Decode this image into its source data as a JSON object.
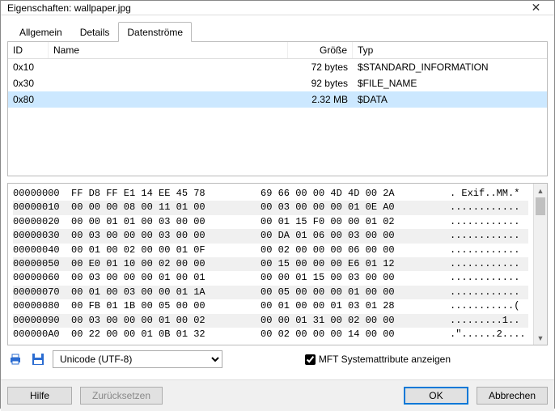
{
  "window": {
    "title": "Eigenschaften: wallpaper.jpg"
  },
  "tabs": {
    "t0": "Allgemein",
    "t1": "Details",
    "t2": "Datenströme"
  },
  "table": {
    "head": {
      "id": "ID",
      "name": "Name",
      "size": "Größe",
      "type": "Typ"
    },
    "rows": [
      {
        "id": "0x10",
        "name": "",
        "size": "72 bytes",
        "type": "$STANDARD_INFORMATION",
        "sel": false
      },
      {
        "id": "0x30",
        "name": "",
        "size": "92 bytes",
        "type": "$FILE_NAME",
        "sel": false
      },
      {
        "id": "0x80",
        "name": "",
        "size": "2.32 MB",
        "type": "$DATA",
        "sel": true
      }
    ]
  },
  "hex": {
    "lines": [
      {
        "off": "00000000",
        "b1": "FF D8 FF E1 14 EE 45 78",
        "b2": "69 66 00 00 4D 4D 00 2A",
        "ascii": ". Exif..MM.*"
      },
      {
        "off": "00000010",
        "b1": "00 00 00 08 00 11 01 00",
        "b2": "00 03 00 00 00 01 0E A0",
        "ascii": "............"
      },
      {
        "off": "00000020",
        "b1": "00 00 01 01 00 03 00 00",
        "b2": "00 01 15 F0 00 00 01 02",
        "ascii": "............"
      },
      {
        "off": "00000030",
        "b1": "00 03 00 00 00 03 00 00",
        "b2": "00 DA 01 06 00 03 00 00",
        "ascii": "............"
      },
      {
        "off": "00000040",
        "b1": "00 01 00 02 00 00 01 0F",
        "b2": "00 02 00 00 00 06 00 00",
        "ascii": "............"
      },
      {
        "off": "00000050",
        "b1": "00 E0 01 10 00 02 00 00",
        "b2": "00 15 00 00 00 E6 01 12",
        "ascii": "............"
      },
      {
        "off": "00000060",
        "b1": "00 03 00 00 00 01 00 01",
        "b2": "00 00 01 15 00 03 00 00",
        "ascii": "............"
      },
      {
        "off": "00000070",
        "b1": "00 01 00 03 00 00 01 1A",
        "b2": "00 05 00 00 00 01 00 00",
        "ascii": "............"
      },
      {
        "off": "00000080",
        "b1": "00 FB 01 1B 00 05 00 00",
        "b2": "00 01 00 00 01 03 01 28",
        "ascii": "...........("
      },
      {
        "off": "00000090",
        "b1": "00 03 00 00 00 01 00 02",
        "b2": "00 00 01 31 00 02 00 00",
        "ascii": ".........1.."
      },
      {
        "off": "000000A0",
        "b1": "00 22 00 00 01 0B 01 32",
        "b2": "00 02 00 00 00 14 00 00",
        "ascii": ".\"......2...."
      }
    ]
  },
  "encoding": {
    "value": "Unicode (UTF-8)"
  },
  "mft": {
    "label": "MFT Systemattribute anzeigen",
    "checked": true
  },
  "footer": {
    "help": "Hilfe",
    "reset": "Zurücksetzen",
    "ok": "OK",
    "cancel": "Abbrechen"
  }
}
